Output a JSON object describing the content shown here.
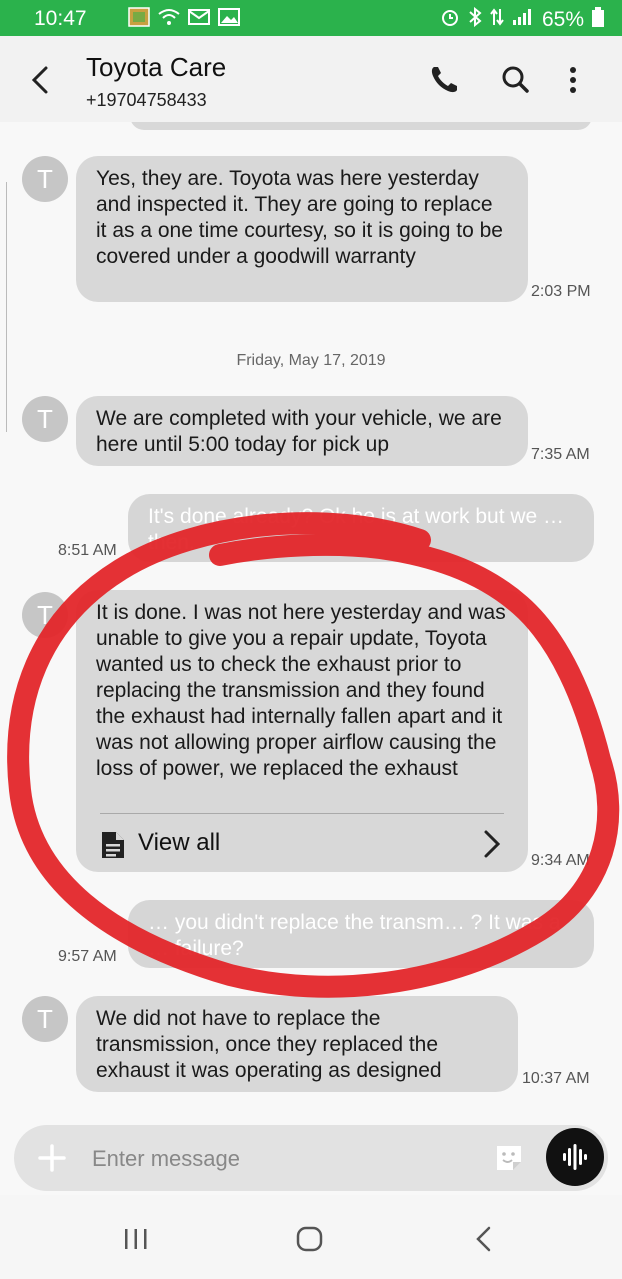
{
  "status_bar": {
    "time": "10:47",
    "battery": "65%",
    "icons": [
      "gallery-icon",
      "wifi-icon",
      "email-icon",
      "image-icon",
      "alarm-icon",
      "bluetooth-icon",
      "data-icon",
      "signal-icon",
      "battery-icon"
    ]
  },
  "header": {
    "contact_name": "Toyota Care",
    "contact_number": "+19704758433",
    "icons": [
      "back-icon",
      "phone-icon",
      "search-icon",
      "more-vert-icon"
    ]
  },
  "messages": [
    {
      "direction": "in",
      "avatar_letter": "T",
      "text": "Yes, they are. Toyota was here yesterday and inspected it. They are going to replace it as a one time courtesy, so it is going to be covered under a goodwill warranty",
      "time": "2:03 PM"
    },
    {
      "direction": "separator",
      "text": "Friday, May 17, 2019"
    },
    {
      "direction": "in",
      "avatar_letter": "T",
      "text": "We are completed with your vehicle, we are here until 5:00 today for pick up",
      "time": "7:35 AM"
    },
    {
      "direction": "out",
      "text": "It's done already? Ok he is at work but we … then.",
      "time": "8:51 AM"
    },
    {
      "direction": "in",
      "avatar_letter": "T",
      "text": "It is done. I was not here yesterday and was unable to give you a repair update, Toyota wanted us to check the exhaust prior to replacing the transmission and they found the exhaust had internally fallen apart and it was not allowing proper airflow causing the loss of power, we replaced the exhaust",
      "view_all": "View all",
      "time": "9:34 AM"
    },
    {
      "direction": "out",
      "text": "… you didn't replace the transm… ? It was a … failure?",
      "time": "9:57 AM"
    },
    {
      "direction": "in",
      "avatar_letter": "T",
      "text": "We did not have to replace the transmission, once they replaced the exhaust it was operating as designed",
      "time": "10:37 AM"
    }
  ],
  "input": {
    "placeholder": "Enter message"
  },
  "colors": {
    "status_bar": "#2bb24c",
    "bubble": "#d8d8d8",
    "annotation": "#e3262a"
  }
}
